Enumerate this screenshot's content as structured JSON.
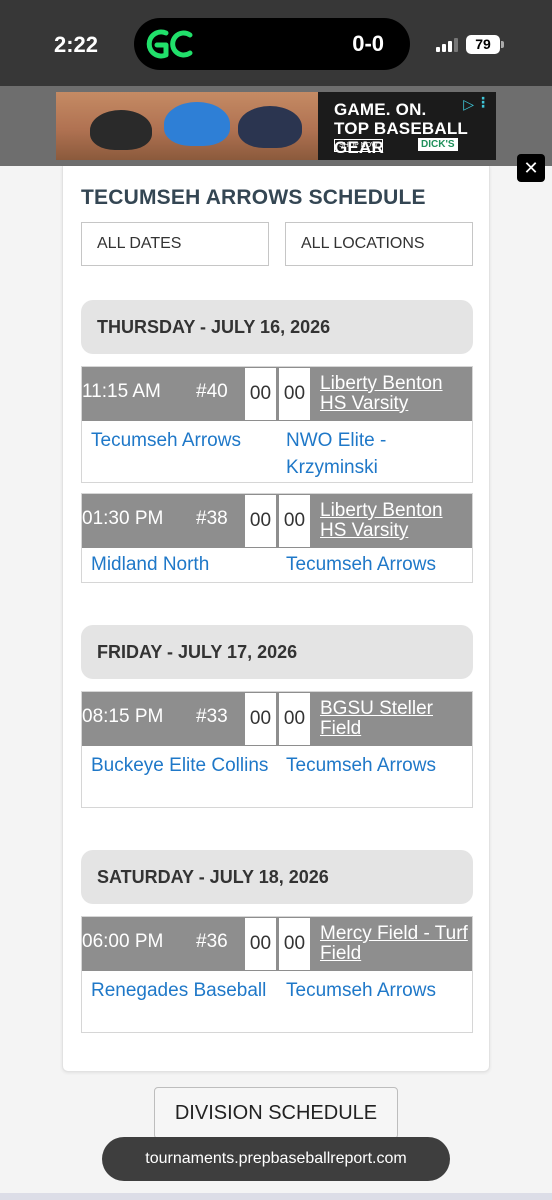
{
  "status_bar": {
    "time": "2:22",
    "score": "0-0",
    "battery": "79"
  },
  "ad": {
    "headline_line1": "GAME. ON.",
    "headline_line2": "TOP BASEBALL GEAR",
    "shop_now": "SHOP NOW",
    "brand": "DICK'S"
  },
  "schedule": {
    "title": "TECUMSEH ARROWS SCHEDULE",
    "filter_dates": "ALL DATES",
    "filter_locations": "ALL LOCATIONS",
    "days": [
      {
        "header": "THURSDAY - JULY 16, 2026",
        "games": [
          {
            "time": "11:15 AM",
            "number": "#40",
            "score1": "00",
            "score2": "00",
            "location": "Liberty Benton HS Varsity",
            "team1": "Tecumseh Arrows",
            "team2": "NWO Elite - Krzyminski"
          },
          {
            "time": "01:30 PM",
            "number": "#38",
            "score1": "00",
            "score2": "00",
            "location": "Liberty Benton HS Varsity",
            "team1": "Midland North",
            "team2": "Tecumseh Arrows"
          }
        ]
      },
      {
        "header": "FRIDAY - JULY 17, 2026",
        "games": [
          {
            "time": "08:15 PM",
            "number": "#33",
            "score1": "00",
            "score2": "00",
            "location": "BGSU Steller Field",
            "team1": "Buckeye Elite Collins",
            "team2": "Tecumseh Arrows"
          }
        ]
      },
      {
        "header": "SATURDAY - JULY 18, 2026",
        "games": [
          {
            "time": "06:00 PM",
            "number": "#36",
            "score1": "00",
            "score2": "00",
            "location": "Mercy Field - Turf Field",
            "team1": "Renegades Baseball",
            "team2": "Tecumseh Arrows"
          }
        ]
      }
    ],
    "division_button": "DIVISION SCHEDULE"
  },
  "browser": {
    "url": "tournaments.prepbaseballreport.com"
  },
  "colors": {
    "link": "#1f78c8",
    "game_header": "#8e8e8e",
    "title": "#344653",
    "logo_green": "#21e06b"
  },
  "icons": [
    "gamechanger-logo-icon",
    "signal-icon",
    "battery-icon",
    "close-icon",
    "adchoices-icon",
    "more-icon"
  ]
}
